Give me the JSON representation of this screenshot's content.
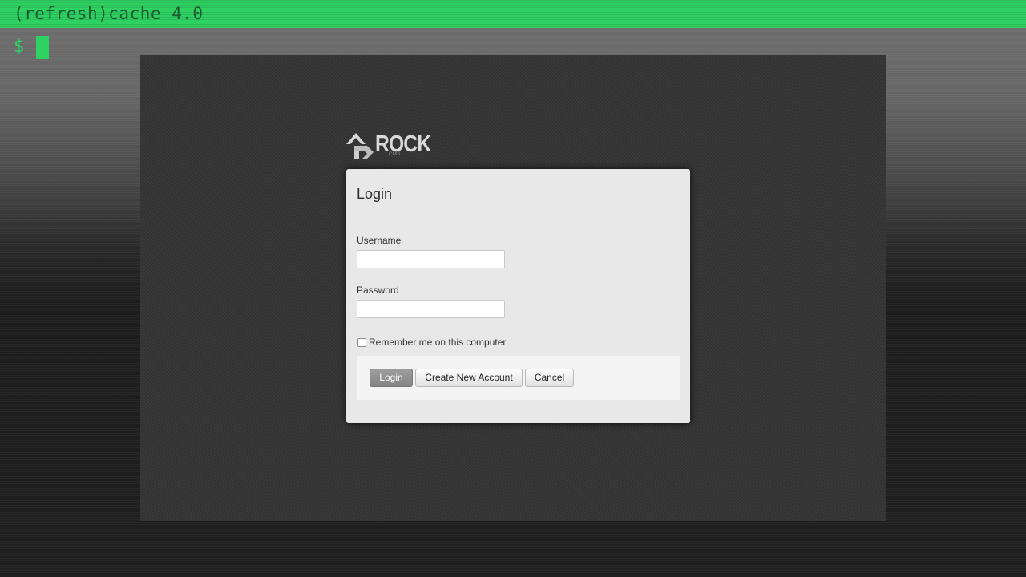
{
  "terminal": {
    "title": "(refresh)cache 4.0",
    "prompt": "$"
  },
  "colors": {
    "title_bar": "#2ed162",
    "title_text": "#1d5a30",
    "panel_bg": "#e8e8e8",
    "primary_button": "#8f8f8f"
  },
  "logo": {
    "text": "ROCK",
    "subtext": "CMS",
    "icon": "rock-arrow-icon"
  },
  "login": {
    "title": "Login",
    "username_label": "Username",
    "username_value": "",
    "password_label": "Password",
    "password_value": "",
    "remember_label": "Remember me on this computer",
    "remember_checked": false,
    "login_button": "Login",
    "create_account_button": "Create New Account",
    "cancel_button": "Cancel"
  }
}
